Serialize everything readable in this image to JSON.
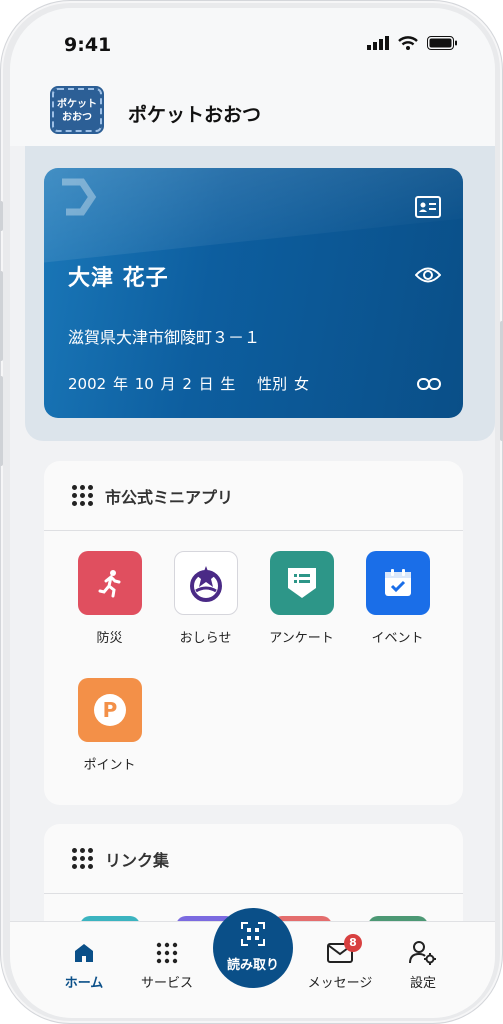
{
  "status": {
    "time": "9:41"
  },
  "app": {
    "title": "ポケットおおつ",
    "logo_text": "ポケット おおつ"
  },
  "card": {
    "name": "大津 花子",
    "address": "滋賀県大津市御陵町３－１",
    "birth": "2002 年 10 月 2 日 生　 性別 女",
    "icons": [
      "id-card-icon",
      "eye-icon",
      "link-icon"
    ]
  },
  "mini_apps": {
    "title": "市公式ミニアプリ",
    "items": [
      {
        "label": "防災",
        "icon": "running-person-icon",
        "color": "#e04f5f"
      },
      {
        "label": "おしらせ",
        "icon": "city-emblem-icon",
        "color": "#ffffff"
      },
      {
        "label": "アンケート",
        "icon": "survey-icon",
        "color": "#2d9688"
      },
      {
        "label": "イベント",
        "icon": "calendar-check-icon",
        "color": "#1a6ee8"
      },
      {
        "label": "ポイント",
        "icon": "points-p-icon",
        "color": "#f39048"
      }
    ]
  },
  "links": {
    "title": "リンク集"
  },
  "nav": {
    "home": "ホーム",
    "services": "サービス",
    "scan": "読み取り",
    "messages": "メッセージ",
    "messages_badge": "8",
    "settings": "設定"
  },
  "colors": {
    "primary": "#0a4f88",
    "badge": "#d84040"
  }
}
